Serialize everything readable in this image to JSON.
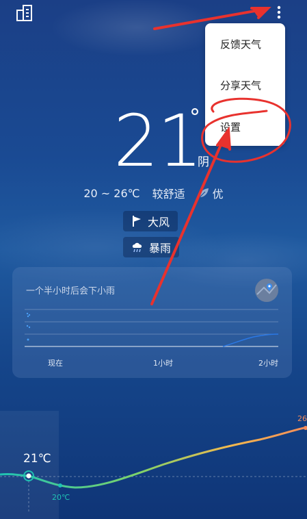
{
  "current": {
    "temp": "21",
    "degree_symbol": "°",
    "condition": "阴"
  },
  "info": {
    "range": "20 ~ 26℃",
    "comfort": "较舒适",
    "air_quality": "优"
  },
  "alerts": [
    {
      "label": "大风",
      "icon": "flag-icon"
    },
    {
      "label": "暴雨",
      "icon": "rain-cloud-icon"
    }
  ],
  "rain_forecast": {
    "summary": "一个半小时后会下小雨",
    "ticks": [
      "现在",
      "1小时",
      "2小时"
    ]
  },
  "menu": {
    "items": [
      "反馈天气",
      "分享天气",
      "设置"
    ]
  },
  "hourly_temps": {
    "current_label": "21℃",
    "low_label": "20℃",
    "high_label": "26"
  },
  "colors": {
    "annotation_red": "#e8322e",
    "rain_line": "#2b78e4"
  }
}
